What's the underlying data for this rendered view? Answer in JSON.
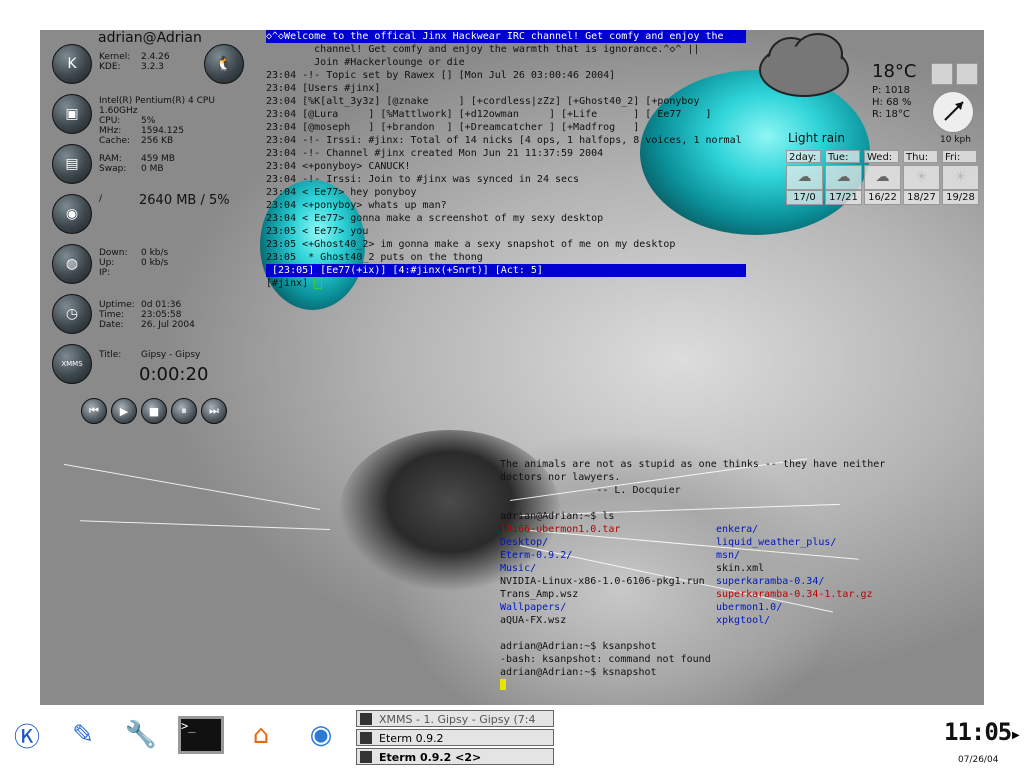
{
  "sidebar": {
    "user_host": "adrian@Adrian",
    "kernel_label": "Kernel:",
    "kernel_value": "2.4.26",
    "kde_label": "KDE:",
    "kde_value": "3.2.3",
    "cpu_model": "Intel(R) Pentium(R) 4 CPU 1.60GHz",
    "cpu_label": "CPU:",
    "cpu_value": "5%",
    "mhz_label": "MHz:",
    "mhz_value": "1594.125",
    "cache_label": "Cache:",
    "cache_value": "256 KB",
    "ram_label": "RAM:",
    "ram_value": "459 MB",
    "swap_label": "Swap:",
    "swap_value": "0 MB",
    "disk_mount": "/",
    "disk_value": "2640 MB / 5%",
    "down_label": "Down:",
    "down_value": "0 kb/s",
    "up_label": "Up:",
    "up_value": "0 kb/s",
    "ip_label": "IP:",
    "uptime_label": "Uptime:",
    "uptime_value": "0d 01:36",
    "time_label": "Time:",
    "time_value": "23:05:58",
    "date_label": "Date:",
    "date_value": "26. Jul 2004",
    "title_label": "Title:",
    "title_value": "Gipsy - Gipsy",
    "elapsed": "0:00:20",
    "xmms_label": "XMMS"
  },
  "irc": {
    "lines": [
      {
        "cls": "blue-bar",
        "text": "◇^◇Welcome to the offical Jinx Hackwear IRC channel! Get comfy and enjoy the"
      },
      {
        "cls": "",
        "text": "        channel! Get comfy and enjoy the warmth that is ignorance.^◇^ ||"
      },
      {
        "cls": "",
        "text": "        Join #Hackerlounge or die"
      },
      {
        "cls": "",
        "text": "23:04 -!- Topic set by Rawex [] [Mon Jul 26 03:00:46 2004]"
      },
      {
        "cls": "",
        "text": "23:04 [Users #jinx]"
      },
      {
        "cls": "",
        "text": "23:04 [%K[alt_3y3z] [@znake     ] [+cordless|zZz] [+Ghost40_2] [+ponyboy"
      },
      {
        "cls": "",
        "text": "23:04 [@Lura     ] [%Mattlwork] [+d12owman     ] [+Life      ] [ Ee77    ]"
      },
      {
        "cls": "",
        "text": "23:04 [@moseph   ] [+brandon  ] [+Dreamcatcher ] [+Madfrog   ]"
      },
      {
        "cls": "",
        "text": "23:04 -!- Irssi: #jinx: Total of 14 nicks [4 ops, 1 halfops, 8 voices, 1 normal"
      },
      {
        "cls": "",
        "text": "23:04 -!- Channel #jinx created Mon Jun 21 11:37:59 2004"
      },
      {
        "cls": "",
        "text": "23:04 <+ponyboy> CANUCK!"
      },
      {
        "cls": "",
        "text": "23:04 -!- Irssi: Join to #jinx was synced in 24 secs"
      },
      {
        "cls": "",
        "text": "23:04 < Ee77> hey ponyboy"
      },
      {
        "cls": "",
        "text": "23:04 <+ponyboy> whats up man?"
      },
      {
        "cls": "",
        "text": "23:04 < Ee77> gonna make a screenshot of my sexy desktop"
      },
      {
        "cls": "",
        "text": "23:05 < Ee77> you"
      },
      {
        "cls": "",
        "text": "23:05 <+Ghost40_2> im gonna make a sexy snapshot of me on my desktop"
      },
      {
        "cls": "",
        "text": "23:05  * Ghost40_2 puts on the thong"
      },
      {
        "cls": "blue-bar",
        "text": " [23:05] [Ee77(+ix)] [4:#jinx(+Snrt)] [Act: 5]"
      }
    ],
    "prompt": "[#jinx] "
  },
  "terminal": {
    "fortune": [
      "The animals are not as stupid as one thinks -- they have neither",
      "doctors nor lawyers.",
      "                -- L. Docquier"
    ],
    "prompt_ls": "adrian@Adrian:~$ ls",
    "col1": [
      {
        "cls": "arch",
        "text": "13166-ubermon1.0.tar"
      },
      {
        "cls": "dir",
        "text": "Desktop/"
      },
      {
        "cls": "dir",
        "text": "Eterm-0.9.2/"
      },
      {
        "cls": "dir",
        "text": "Music/"
      },
      {
        "cls": "plain",
        "text": "NVIDIA-Linux-x86-1.0-6106-pkg1.run"
      },
      {
        "cls": "plain",
        "text": "Trans_Amp.wsz"
      },
      {
        "cls": "dir",
        "text": "Wallpapers/"
      },
      {
        "cls": "plain",
        "text": "aQUA-FX.wsz"
      }
    ],
    "col2": [
      {
        "cls": "dir",
        "text": "enkera/"
      },
      {
        "cls": "dir",
        "text": "liquid_weather_plus/"
      },
      {
        "cls": "dir",
        "text": "msn/"
      },
      {
        "cls": "plain",
        "text": "skin.xml"
      },
      {
        "cls": "dir",
        "text": "superkaramba-0.34/"
      },
      {
        "cls": "arch",
        "text": "superkaramba-0.34-1.tar.gz"
      },
      {
        "cls": "dir",
        "text": "ubermon1.0/"
      },
      {
        "cls": "dir",
        "text": "xpkgtool/"
      }
    ],
    "after": [
      "adrian@Adrian:~$ ksanpshot",
      "-bash: ksanpshot: command not found",
      "adrian@Adrian:~$ ksnapshot"
    ]
  },
  "weather": {
    "temp": "18°C",
    "pressure": "P: 1018",
    "humidity": "H: 68 %",
    "real": "R: 18°C",
    "condition": "Light rain",
    "wind": "10 kph",
    "days": [
      {
        "name": "2day:",
        "temps": "17/0"
      },
      {
        "name": "Tue:",
        "temps": "17/21"
      },
      {
        "name": "Wed:",
        "temps": "16/22"
      },
      {
        "name": "Thu:",
        "temps": "18/27"
      },
      {
        "name": "Fri:",
        "temps": "19/28"
      }
    ]
  },
  "taskbar": {
    "tasks": [
      {
        "label": "XMMS - 1. Gipsy - Gipsy (7:4"
      },
      {
        "label": "Eterm 0.9.2"
      },
      {
        "label": "Eterm 0.9.2 <2>"
      }
    ],
    "clock": "11:05",
    "date": "07/26/04"
  }
}
